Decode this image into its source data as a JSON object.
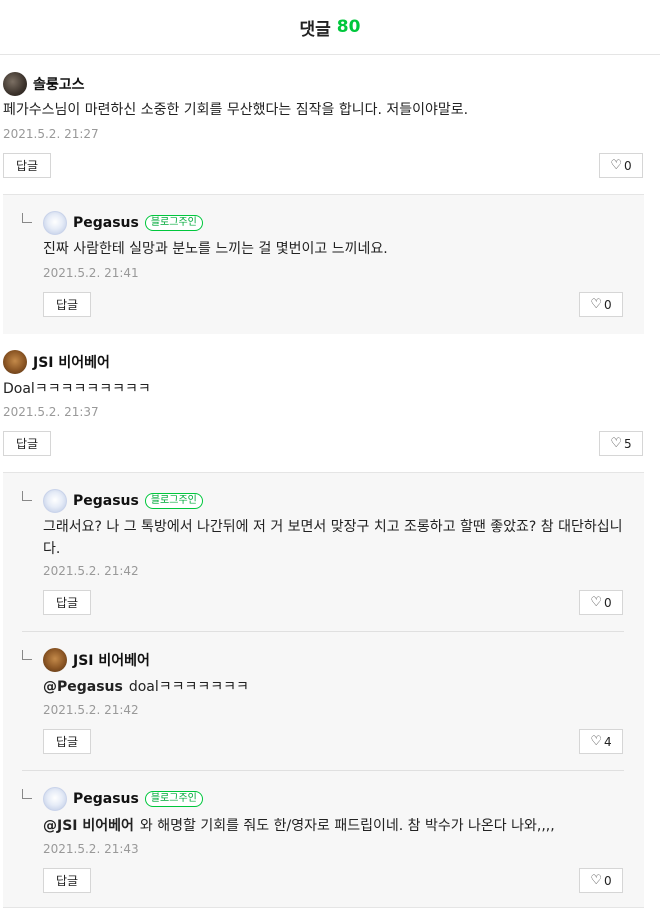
{
  "header": {
    "title": "댓글",
    "count": "80"
  },
  "comments": [
    {
      "author": "솔룽고스",
      "text": "페가수스님이 마련하신 소중한 기회를 무산했다는 짐작을 합니다. 저들이야말로.",
      "date": "2021.5.2. 21:27",
      "reply_label": "답글",
      "likes": "0"
    },
    {
      "author": "Pegasus",
      "badge": "블로그주인",
      "text": "진짜 사람한테 실망과 분노를 느끼는 걸 몇번이고 느끼네요.",
      "date": "2021.5.2. 21:41",
      "reply_label": "답글",
      "likes": "0"
    },
    {
      "author": "JSI 비어베어",
      "text": "Doalㅋㅋㅋㅋㅋㅋㅋㅋㅋ",
      "date": "2021.5.2. 21:37",
      "reply_label": "답글",
      "likes": "5"
    },
    {
      "author": "Pegasus",
      "badge": "블로그주인",
      "text": "그래서요? 나 그 톡방에서 나간뒤에 저 거 보면서 맞장구 치고 조롱하고 할땐 좋았죠? 참 대단하십니다.",
      "date": "2021.5.2. 21:42",
      "reply_label": "답글",
      "likes": "0"
    },
    {
      "author": "JSI 비어베어",
      "mention": "@Pegasus",
      "text": "doalㅋㅋㅋㅋㅋㅋㅋ",
      "date": "2021.5.2. 21:42",
      "reply_label": "답글",
      "likes": "4"
    },
    {
      "author": "Pegasus",
      "badge": "블로그주인",
      "mention": "@JSI 비어베어",
      "text": "와 해명할 기회를 줘도 한/영자로 패드립이네. 참 박수가 나온다 나와,,,,",
      "date": "2021.5.2. 21:43",
      "reply_label": "답글",
      "likes": "0"
    }
  ]
}
